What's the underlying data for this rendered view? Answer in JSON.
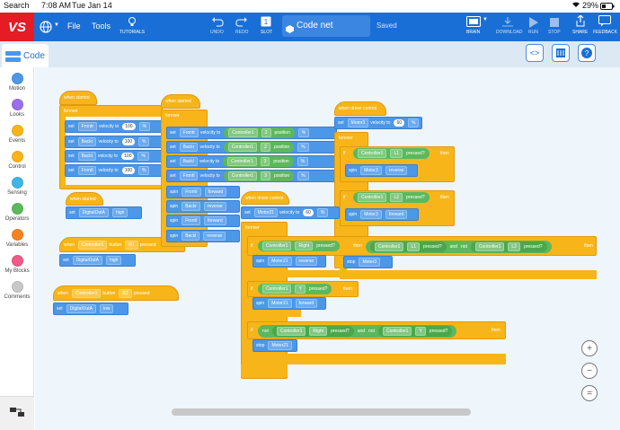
{
  "status": {
    "back": "Search",
    "time": "7:08 AM",
    "date": "Tue Jan 14",
    "battery": "29%"
  },
  "topbar": {
    "logo": "VS",
    "file": "File",
    "tools": "Tools",
    "tutorials": "TUTORIALS",
    "undo": "UNDO",
    "redo": "REDO",
    "slot": "SLOT",
    "project_name": "Code net",
    "saved": "Saved",
    "brain": "BRAIN",
    "download": "DOWNLOAD",
    "run": "RUN",
    "stop": "STOP",
    "share": "SHARE",
    "feedback": "FEEDBACK"
  },
  "tabs": {
    "code": "Code"
  },
  "palette": [
    {
      "label": "Motion",
      "color": "#4c97e8"
    },
    {
      "label": "Looks",
      "color": "#9c6ee8"
    },
    {
      "label": "Events",
      "color": "#f7b519"
    },
    {
      "label": "Control",
      "color": "#f7b519"
    },
    {
      "label": "Sensing",
      "color": "#3fb5e8"
    },
    {
      "label": "Operators",
      "color": "#5cb85c"
    },
    {
      "label": "Variables",
      "color": "#f58220"
    },
    {
      "label": "My Blocks",
      "color": "#ef5b88"
    },
    {
      "label": "Comments",
      "color": "#c8c8c8"
    }
  ],
  "blocks": {
    "when_started": "when started",
    "forever": "forever",
    "set": "set",
    "velocity_to": "velocity to",
    "pct": "%",
    "v100": "100",
    "v60": "60",
    "frontr": "Frontr",
    "backr": "Backr",
    "backl": "Backl",
    "frontl": "Frontl",
    "digital_out_a": "DigitalOutA",
    "high": "high",
    "low": "low",
    "when": "when",
    "controller1": "Controller1",
    "button": "button",
    "r1": "R1",
    "r2": "R2",
    "pressed": "pressed",
    "pressed_q": "pressed?",
    "position": "position",
    "n2": "2",
    "n3": "3",
    "spin": "spin",
    "forward": "forward",
    "reverse": "reverse",
    "when_driver_control": "when driver control",
    "motor21": "Motor21",
    "motor3": "Motor3",
    "if": "if",
    "then": "then",
    "and": "and",
    "not": "not",
    "right": "Right",
    "y": "Y",
    "l1": "L1",
    "l2": "L2",
    "stop": "stop"
  },
  "zoom": {
    "in": "+",
    "out": "−",
    "reset": "="
  }
}
